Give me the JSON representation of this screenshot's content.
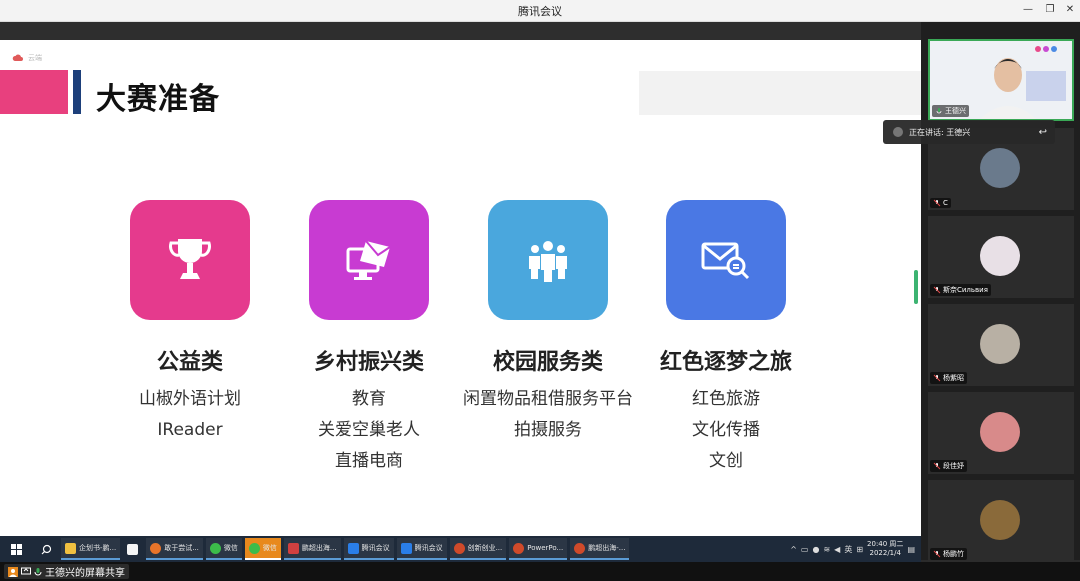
{
  "window": {
    "title": "腾讯会议"
  },
  "slide": {
    "cloud_label": "云端",
    "title": "大赛准备",
    "categories": [
      {
        "title": "公益类",
        "icon": "trophy-icon",
        "color": "#e53a8d",
        "items": [
          "山椒外语计划",
          "IReader"
        ]
      },
      {
        "title": "乡村振兴类",
        "icon": "computer-mail-icon",
        "color": "#c83bd2",
        "items": [
          "教育",
          "关爱空巢老人",
          "直播电商"
        ]
      },
      {
        "title": "校园服务类",
        "icon": "people-group-icon",
        "color": "#4aa7dd",
        "items": [
          "闲置物品租借服务平台",
          "拍摄服务"
        ]
      },
      {
        "title": "红色逐梦之旅",
        "icon": "mail-search-icon",
        "color": "#4a78e4",
        "items": [
          "红色旅游",
          "文化传播",
          "文创"
        ]
      }
    ]
  },
  "participants": [
    {
      "name": "王德兴",
      "active": true
    },
    {
      "name": "C",
      "avatar_color": "#6a7a8c"
    },
    {
      "name": "斯奈Сильвия",
      "avatar_color": "#e8e0e6"
    },
    {
      "name": "杨紫昭",
      "avatar_color": "#b8b0a4"
    },
    {
      "name": "段佳妤",
      "avatar_color": "#d88a8a"
    },
    {
      "name": "杨鹏竹",
      "avatar_color": "#8a6a3a"
    }
  ],
  "speaking": {
    "label": "正在讲话: 王德兴"
  },
  "taskbar": {
    "items": [
      {
        "label": "企划书-鹏...",
        "color": "#f0c040"
      },
      {
        "label": "",
        "color": "#f5f5f5",
        "plain": true
      },
      {
        "label": "敢于尝试...",
        "color": "#e8742a"
      },
      {
        "label": "微信",
        "color": "#3cbc4a"
      },
      {
        "label": "微信",
        "color": "#3cbc4a",
        "orange": true
      },
      {
        "label": "鹏超出海...",
        "color": "#d04040"
      },
      {
        "label": "腾讯会议",
        "color": "#2a7ee8"
      },
      {
        "label": "腾讯会议",
        "color": "#2a7ee8"
      },
      {
        "label": "创新创业...",
        "color": "#d04a2a"
      },
      {
        "label": "PowerPo...",
        "color": "#d04a2a"
      },
      {
        "label": "鹏超出海-...",
        "color": "#d04a2a"
      }
    ],
    "tray_lang": "英",
    "time": "20:40 周二",
    "date": "2022/1/4"
  },
  "share": {
    "label": "王德兴的屏幕共享"
  }
}
